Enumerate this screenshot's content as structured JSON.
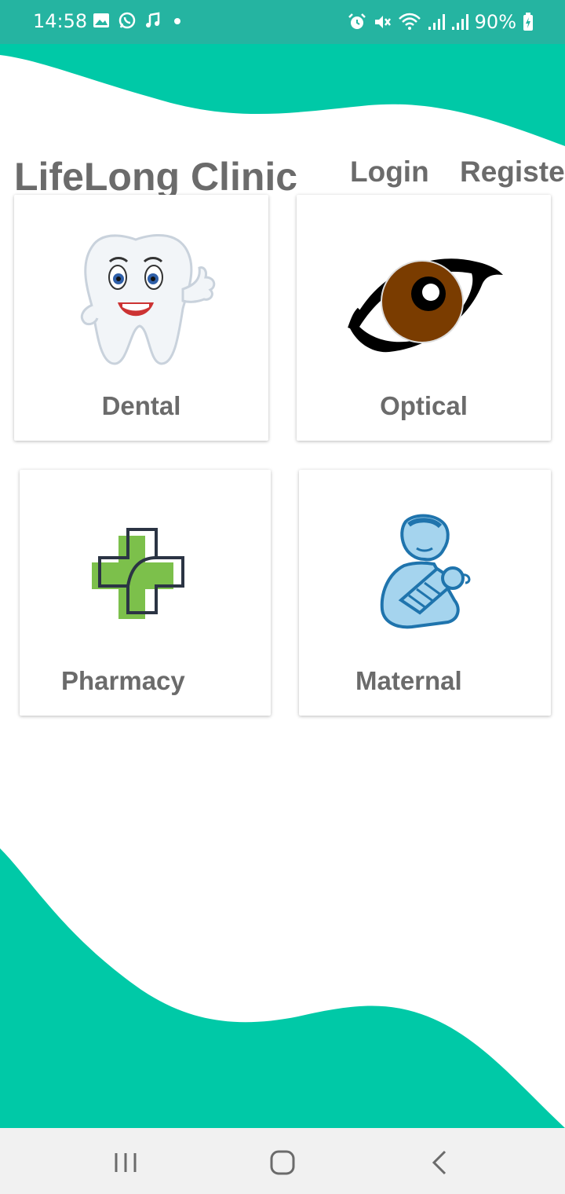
{
  "status_bar": {
    "time": "14:58",
    "battery": "90%",
    "left_icons": [
      "image-icon",
      "whatsapp-icon",
      "music-icon",
      "dot-icon"
    ],
    "right_icons": [
      "alarm-icon",
      "mute-icon",
      "wifi-icon",
      "signal-icon",
      "signal-icon",
      "battery-charging-icon"
    ]
  },
  "header": {
    "title": "LifeLong Clinic",
    "login": "Login",
    "register": "Registe"
  },
  "services": [
    {
      "label": "Dental",
      "icon": "tooth-icon"
    },
    {
      "label": "Optical",
      "icon": "eye-icon"
    },
    {
      "label": "Pharmacy",
      "icon": "pharmacy-cross-icon"
    },
    {
      "label": "Maternal",
      "icon": "mother-baby-icon"
    }
  ],
  "nav_bar": {
    "icons": [
      "recent-apps-icon",
      "home-icon",
      "back-icon"
    ]
  },
  "colors": {
    "accent": "#00c9a7",
    "status_bar": "#25b4a1",
    "text": "#6b6b6b"
  }
}
